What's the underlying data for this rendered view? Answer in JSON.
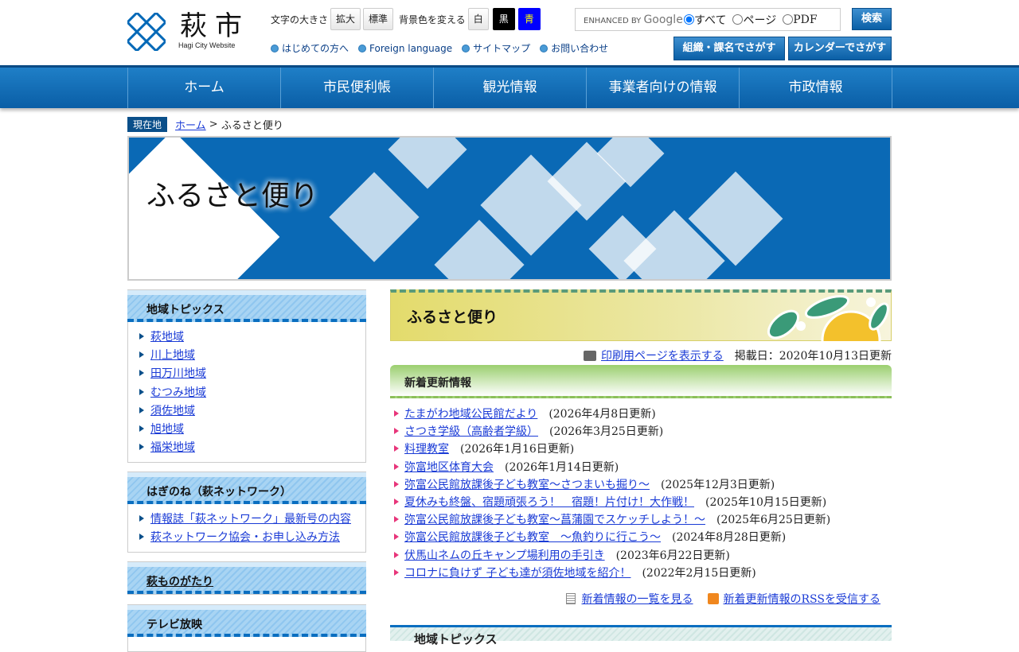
{
  "header": {
    "logo_kanji": "萩市",
    "logo_sub": "Hagi City Website",
    "font_size_label": "文字の大きさ",
    "enlarge": "拡大",
    "standard": "標準",
    "bg_color_label": "背景色を変える",
    "white": "白",
    "black": "黒",
    "blue": "青",
    "links": [
      "はじめての方へ",
      "Foreign language",
      "サイトマップ",
      "お問い合わせ"
    ],
    "search": {
      "enhanced": "ENHANCED BY",
      "google": "Google",
      "options": [
        "すべて",
        "ページ",
        "PDF"
      ],
      "button": "検索"
    },
    "org_button": "組織・課名でさがす",
    "calendar_button": "カレンダーでさがす"
  },
  "nav": [
    "ホーム",
    "市民便利帳",
    "観光情報",
    "事業者向けの情報",
    "市政情報"
  ],
  "breadcrumb": {
    "here": "現在地",
    "home": "ホーム",
    "sep": " > ",
    "current": "ふるさと便り"
  },
  "banner_title": "ふるさと便り",
  "sidebar": [
    {
      "title": "地域トピックス",
      "items": [
        "萩地域",
        "川上地域",
        "田万川地域",
        "むつみ地域",
        "須佐地域",
        "旭地域",
        "福栄地域"
      ]
    },
    {
      "title": "はぎのね（萩ネットワーク）",
      "items": [
        "情報誌「萩ネットワーク」最新号の内容",
        "萩ネットワーク協会・お申し込み方法"
      ]
    },
    {
      "title": "萩ものがたり",
      "items": []
    },
    {
      "title": "テレビ放映",
      "items": []
    }
  ],
  "main": {
    "title": "ふるさと便り",
    "print_link": "印刷用ページを表示する",
    "posted": "掲載日：2020年10月13日更新",
    "news_heading": "新着更新情報",
    "news": [
      {
        "title": "たまがわ地域公民館だより",
        "date": "(2026年4月8日更新)"
      },
      {
        "title": "さつき学級（高齢者学級）",
        "date": "(2026年3月25日更新)"
      },
      {
        "title": "料理教室",
        "date": "(2026年1月16日更新)"
      },
      {
        "title": "弥富地区体育大会",
        "date": "(2026年1月14日更新)"
      },
      {
        "title": "弥富公民館放課後子ども教室～さつまいも掘り～",
        "date": "(2025年12月3日更新)"
      },
      {
        "title": "夏休みも終盤、宿題頑張ろう！　宿題！片付け！大作戦！",
        "date": "(2025年10月15日更新)"
      },
      {
        "title": "弥富公民館放課後子ども教室～菖蒲園でスケッチしよう！～",
        "date": "(2025年6月25日更新)"
      },
      {
        "title": "弥富公民館放課後子ども教室　～魚釣りに行こう～",
        "date": "(2024年8月28日更新)"
      },
      {
        "title": "伏馬山ネムの丘キャンプ場利用の手引き",
        "date": "(2023年6月22日更新)"
      },
      {
        "title": "コロナに負けず 子ども達が須佐地域を紹介！",
        "date": "(2022年2月15日更新)"
      }
    ],
    "list_link": "新着情報の一覧を見る",
    "rss_link": "新着更新情報のRSSを受信する",
    "bottom_heading": "地域トピックス"
  }
}
